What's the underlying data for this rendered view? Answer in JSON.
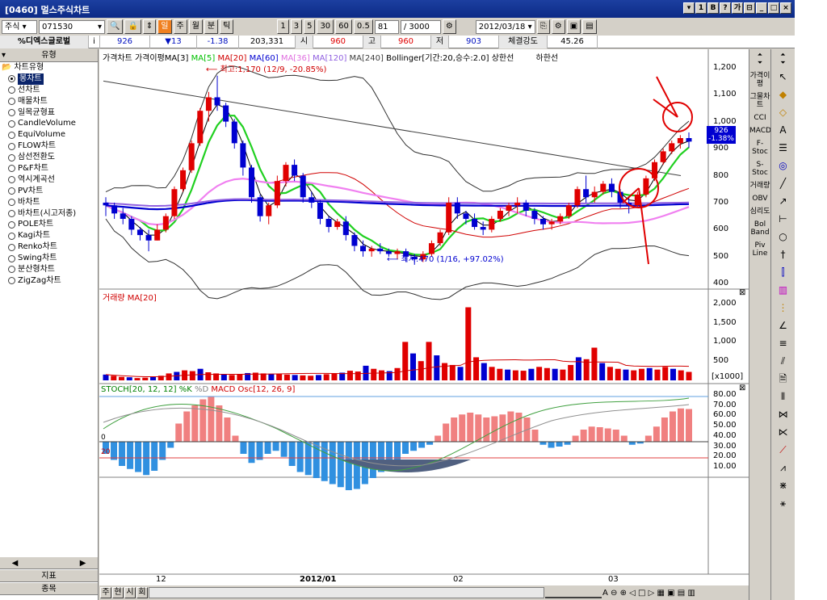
{
  "window": {
    "title": "[0460] 멀스주식차트",
    "buttons": [
      "▾",
      "1",
      "B",
      "?",
      "가",
      "⊟",
      "_",
      "□",
      "×"
    ]
  },
  "toolbar": {
    "market": "주식",
    "code": "071530",
    "search_label": "🔍",
    "periods": [
      "일",
      "주",
      "월",
      "분",
      "틱"
    ],
    "active_period": "일",
    "minute_steps": [
      "1",
      "3",
      "5",
      "30",
      "60",
      "0.5"
    ],
    "count_value": "81",
    "count_total": "/ 3000",
    "date": "2012/03/18"
  },
  "quote": {
    "name": "%디엑스글로벌",
    "info": "i",
    "price": "926",
    "change": "▼13",
    "change_pct": "-1.38",
    "volume": "203,331",
    "open_label": "시",
    "open": "960",
    "high_label": "고",
    "high": "960",
    "low_label": "저",
    "low": "903",
    "strength_label": "체결강도",
    "strength": "45.26"
  },
  "left_panel": {
    "header": "유형",
    "group": "차트유형",
    "items": [
      "봉차트",
      "선차트",
      "매물차트",
      "일목균형표",
      "CandleVolume",
      "EquiVolume",
      "FLOW차트",
      "삼선전환도",
      "P&F차트",
      "역시계곡선",
      "PV차트",
      "바차트",
      "바차트(시고저종)",
      "POLE차트",
      "Kagi차트",
      "Renko차트",
      "Swing차트",
      "분산형차트",
      "ZigZag차트"
    ],
    "selected": "봉차트",
    "bottom_tabs": [
      "지표",
      "종목"
    ]
  },
  "chart": {
    "price_title": "가격차트 가격이평MA[3]",
    "ma_labels": [
      {
        "text": "MA[5]",
        "color": "#00c000"
      },
      {
        "text": "MA[20]",
        "color": "#d00000"
      },
      {
        "text": "MA[60]",
        "color": "#0000d0"
      },
      {
        "text": "MA[36]",
        "color": "#e070e0"
      },
      {
        "text": "MA[120]",
        "color": "#9060e0"
      },
      {
        "text": "MA[240]",
        "color": "#404040"
      }
    ],
    "bollinger": "Bollinger[기간:20,승수:2.0]",
    "upper_label": "상한선",
    "lower_label": "하한선",
    "high_annot": "최고:1,170 (12/9, -20.85%)",
    "low_annot": "최저:470 (1/16, +97.02%)",
    "current_price": "926",
    "current_pct": "-1.38%",
    "price_axis": [
      "1,200",
      "1,100",
      "1,000",
      "900",
      "800",
      "700",
      "600",
      "500",
      "400"
    ],
    "volume_title": "거래량",
    "volume_ma": "MA[20]",
    "volume_axis": [
      "2,000",
      "1,500",
      "1,000",
      "500"
    ],
    "volume_unit": "[x1000]",
    "indicator_title": "STOCH[20, 12, 12]",
    "indicator_k": "%K",
    "indicator_d": "%D",
    "indicator_macd": "MACD Osc[12, 26, 9]",
    "indicator_axis": [
      "80.00",
      "70.00",
      "60.00",
      "50.00",
      "40.00",
      "30.00",
      "20.00",
      "10.00"
    ],
    "indicator_zero": "0",
    "indicator_ref": "20",
    "x_labels": [
      "12",
      "2012/01",
      "02",
      "03"
    ],
    "bottom_tabs": [
      "주",
      "현",
      "시",
      "회"
    ]
  },
  "right_panel": {
    "indicators": [
      "가격이평",
      "그물차트",
      "CCI",
      "MACD",
      "F-Stoc",
      "S-Stoc",
      "거래량",
      "OBV",
      "심리도",
      "Bol Band",
      "Piv Line"
    ]
  },
  "chart_data": {
    "type": "candlestick",
    "x_labels": [
      "12",
      "2012/01",
      "02",
      "03"
    ],
    "ylim": [
      380,
      1220
    ],
    "candles": [
      [
        700,
        720,
        650,
        690
      ],
      [
        690,
        700,
        640,
        660
      ],
      [
        660,
        680,
        620,
        640
      ],
      [
        640,
        650,
        580,
        600
      ],
      [
        600,
        610,
        560,
        580
      ],
      [
        580,
        600,
        520,
        560
      ],
      [
        560,
        620,
        560,
        600
      ],
      [
        600,
        660,
        590,
        650
      ],
      [
        650,
        760,
        640,
        750
      ],
      [
        750,
        830,
        740,
        820
      ],
      [
        820,
        930,
        810,
        920
      ],
      [
        920,
        1050,
        910,
        1040
      ],
      [
        1040,
        1110,
        1000,
        1090
      ],
      [
        1090,
        1170,
        1040,
        1060
      ],
      [
        1060,
        1070,
        980,
        1000
      ],
      [
        1000,
        1010,
        900,
        920
      ],
      [
        920,
        930,
        800,
        830
      ],
      [
        830,
        840,
        700,
        720
      ],
      [
        720,
        730,
        630,
        650
      ],
      [
        650,
        700,
        620,
        690
      ],
      [
        690,
        800,
        680,
        780
      ],
      [
        780,
        850,
        760,
        840
      ],
      [
        840,
        860,
        780,
        800
      ],
      [
        800,
        810,
        700,
        720
      ],
      [
        720,
        740,
        680,
        700
      ],
      [
        700,
        710,
        620,
        640
      ],
      [
        640,
        650,
        590,
        610
      ],
      [
        610,
        640,
        600,
        630
      ],
      [
        630,
        650,
        560,
        580
      ],
      [
        580,
        590,
        520,
        540
      ],
      [
        540,
        560,
        500,
        520
      ],
      [
        520,
        540,
        500,
        530
      ],
      [
        530,
        550,
        510,
        520
      ],
      [
        520,
        530,
        500,
        510
      ],
      [
        510,
        530,
        490,
        520
      ],
      [
        520,
        530,
        480,
        500
      ],
      [
        500,
        510,
        470,
        490
      ],
      [
        490,
        520,
        480,
        510
      ],
      [
        510,
        560,
        500,
        550
      ],
      [
        550,
        600,
        540,
        590
      ],
      [
        590,
        720,
        580,
        700
      ],
      [
        700,
        720,
        640,
        660
      ],
      [
        660,
        670,
        620,
        640
      ],
      [
        640,
        660,
        600,
        610
      ],
      [
        610,
        630,
        580,
        600
      ],
      [
        600,
        650,
        590,
        640
      ],
      [
        640,
        680,
        630,
        670
      ],
      [
        670,
        700,
        650,
        690
      ],
      [
        690,
        720,
        660,
        700
      ],
      [
        700,
        710,
        650,
        670
      ],
      [
        670,
        680,
        620,
        640
      ],
      [
        640,
        650,
        600,
        620
      ],
      [
        620,
        640,
        600,
        630
      ],
      [
        630,
        660,
        620,
        650
      ],
      [
        650,
        700,
        640,
        690
      ],
      [
        690,
        760,
        680,
        750
      ],
      [
        750,
        800,
        700,
        720
      ],
      [
        720,
        760,
        700,
        740
      ],
      [
        740,
        780,
        730,
        770
      ],
      [
        770,
        790,
        720,
        740
      ],
      [
        740,
        750,
        680,
        700
      ],
      [
        700,
        720,
        660,
        690
      ],
      [
        690,
        740,
        680,
        730
      ],
      [
        730,
        800,
        720,
        790
      ],
      [
        790,
        860,
        780,
        850
      ],
      [
        850,
        900,
        840,
        890
      ],
      [
        890,
        930,
        880,
        920
      ],
      [
        920,
        950,
        900,
        939
      ],
      [
        939,
        960,
        903,
        926
      ]
    ],
    "volume": [
      150,
      120,
      90,
      80,
      60,
      70,
      90,
      120,
      180,
      220,
      260,
      240,
      300,
      210,
      180,
      160,
      140,
      160,
      190,
      200,
      180,
      170,
      160,
      150,
      140,
      130,
      120,
      140,
      160,
      180,
      200,
      250,
      230,
      380,
      300,
      260,
      240,
      320,
      1000,
      700,
      500,
      1000,
      650,
      450,
      400,
      350,
      1900,
      600,
      450,
      350,
      300,
      280,
      260,
      250,
      300,
      350,
      320,
      300,
      280,
      400,
      600,
      550,
      850,
      450,
      350,
      300,
      280,
      260,
      300,
      320,
      280,
      350,
      300,
      260,
      220
    ],
    "macd_osc": [
      -20,
      -30,
      -40,
      -45,
      -50,
      -55,
      -48,
      -30,
      -10,
      30,
      50,
      60,
      70,
      75,
      60,
      40,
      10,
      -20,
      -35,
      -30,
      -20,
      -15,
      -25,
      -40,
      -50,
      -55,
      -60,
      -65,
      -70,
      -75,
      -80,
      -78,
      -70,
      -60,
      -50,
      -40,
      -30,
      -20,
      -15,
      -10,
      -5,
      10,
      30,
      40,
      45,
      48,
      45,
      40,
      42,
      45,
      50,
      48,
      40,
      20,
      -5,
      -10,
      -8,
      -5,
      10,
      20,
      25,
      24,
      22,
      20,
      10,
      -5,
      -3,
      10,
      25,
      40,
      50,
      55,
      54
    ]
  }
}
